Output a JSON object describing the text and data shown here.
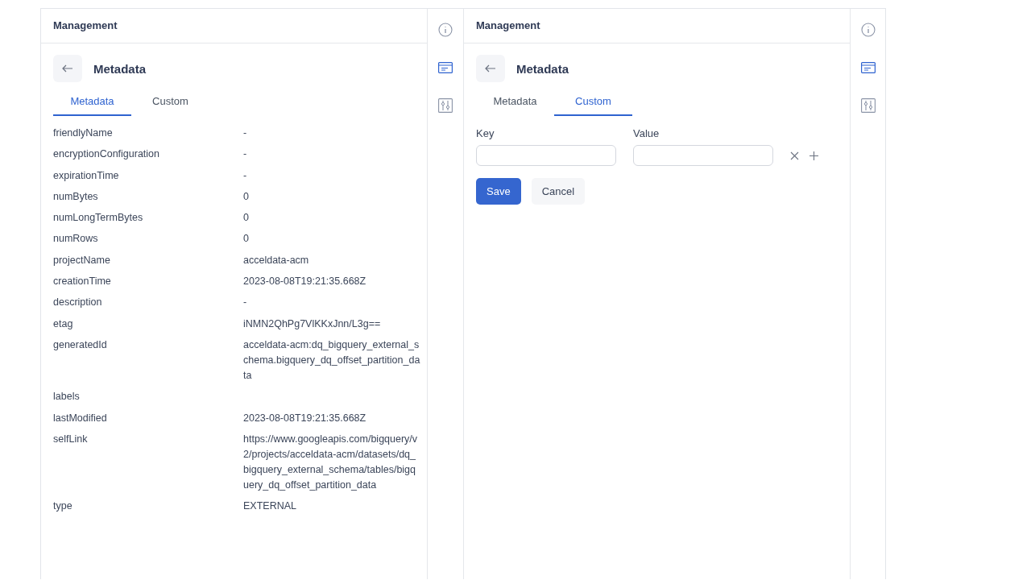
{
  "panels": [
    {
      "kind": "list",
      "header": "Management",
      "title": "Metadata",
      "tabs": [
        {
          "label": "Metadata",
          "selected": true
        },
        {
          "label": "Custom",
          "selected": false
        }
      ],
      "rows": [
        {
          "key": "friendlyName",
          "value": "-"
        },
        {
          "key": "encryptionConfiguration",
          "value": "-"
        },
        {
          "key": "expirationTime",
          "value": "-"
        },
        {
          "key": "numBytes",
          "value": "0"
        },
        {
          "key": "numLongTermBytes",
          "value": "0"
        },
        {
          "key": "numRows",
          "value": "0"
        },
        {
          "key": "projectName",
          "value": "acceldata-acm"
        },
        {
          "key": "creationTime",
          "value": "2023-08-08T19:21:35.668Z"
        },
        {
          "key": "description",
          "value": "-"
        },
        {
          "key": "etag",
          "value": "iNMN2QhPg7VlKKxJnn/L3g=="
        },
        {
          "key": "generatedId",
          "value": "acceldata-acm:dq_bigquery_external_schema.bigquery_dq_offset_partition_data"
        },
        {
          "key": "labels"
        },
        {
          "key": "lastModified",
          "value": "2023-08-08T19:21:35.668Z"
        },
        {
          "key": "selfLink",
          "value": "https://www.googleapis.com/bigquery/v2/projects/acceldata-acm/datasets/dq_bigquery_external_schema/tables/bigquery_dq_offset_partition_data"
        },
        {
          "key": "type",
          "value": "EXTERNAL"
        }
      ],
      "rail": [
        {
          "kind": "info",
          "selected": false
        },
        {
          "kind": "card",
          "selected": true
        },
        {
          "kind": "sliders",
          "selected": false
        }
      ]
    },
    {
      "kind": "form",
      "header": "Management",
      "title": "Metadata",
      "tabs": [
        {
          "label": "Metadata",
          "selected": false
        },
        {
          "label": "Custom",
          "selected": true
        }
      ],
      "key_label": "Key",
      "value_label": "Value",
      "buttons": [
        "Save",
        "Cancel"
      ],
      "rail": [
        {
          "kind": "info",
          "selected": false
        },
        {
          "kind": "card",
          "selected": true
        },
        {
          "kind": "sliders",
          "selected": false
        }
      ]
    }
  ]
}
